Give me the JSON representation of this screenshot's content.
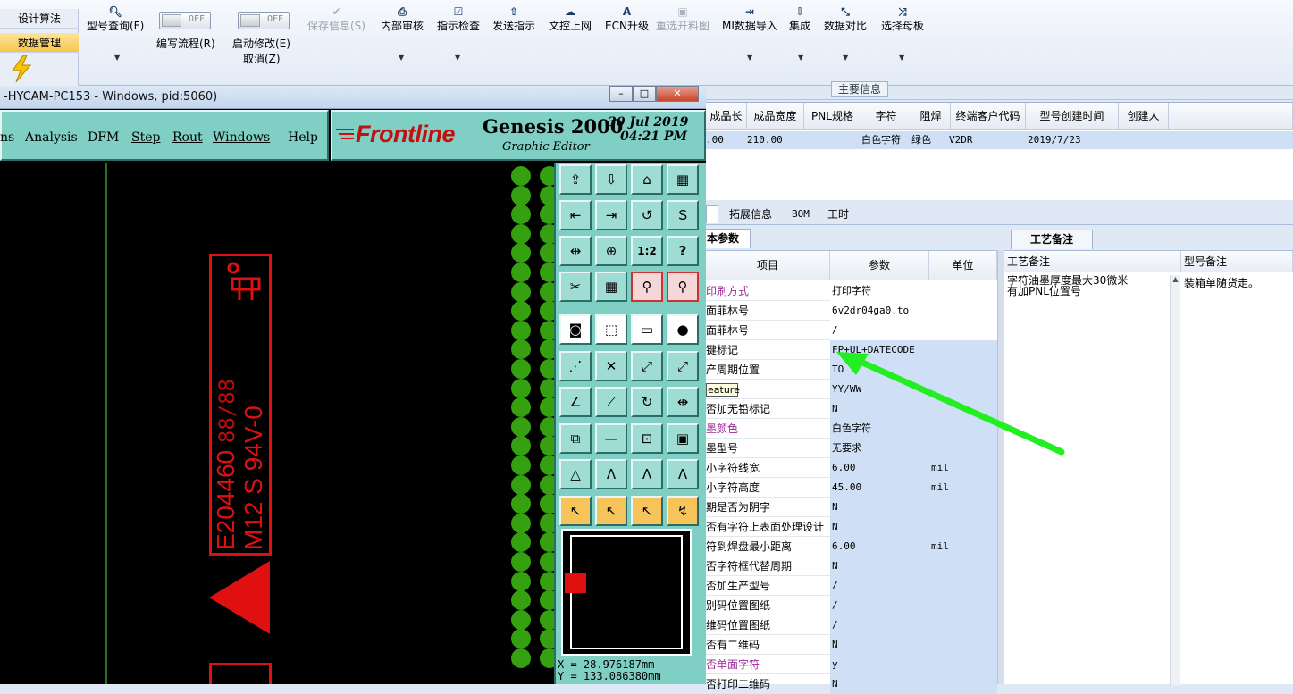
{
  "ribbon": {
    "nav": [
      "设计算法",
      "数据管理"
    ],
    "buttons": [
      {
        "label": "型号查询(F)",
        "icon": "search-icon",
        "enabled": true,
        "dropdown": true
      },
      {
        "label": "编写流程(R)",
        "icon": "toggle-switch",
        "enabled": true,
        "dropdown": false
      },
      {
        "label": "启动修改(E)",
        "label2": "取消(Z)",
        "icon": "toggle-switch",
        "enabled": true,
        "dropdown": false
      },
      {
        "label": "保存信息(S)",
        "icon": "check-icon",
        "enabled": false,
        "dropdown": false
      },
      {
        "label": "内部审核",
        "icon": "printer-icon",
        "enabled": true,
        "dropdown": true
      },
      {
        "label": "指示检查",
        "icon": "checkbox-icon",
        "enabled": true,
        "dropdown": true
      },
      {
        "label": "发送指示",
        "icon": "upload-icon",
        "enabled": true,
        "dropdown": false
      },
      {
        "label": "文控上网",
        "icon": "cloud-upload-icon",
        "enabled": true,
        "dropdown": false
      },
      {
        "label": "ECN升级",
        "icon": "ecn-icon",
        "enabled": true,
        "dropdown": false
      },
      {
        "label": "重选开料图",
        "icon": "image-icon",
        "enabled": false,
        "dropdown": false
      },
      {
        "label": "MI数据导入",
        "icon": "import-icon",
        "enabled": true,
        "dropdown": true
      },
      {
        "label": "集成",
        "icon": "download-icon",
        "enabled": true,
        "dropdown": true
      },
      {
        "label": "数据对比",
        "icon": "compare-icon",
        "enabled": true,
        "dropdown": true
      },
      {
        "label": "选择母板",
        "icon": "shuffle-icon",
        "enabled": true,
        "dropdown": true
      }
    ],
    "toggle_text": "OFF"
  },
  "main_info": {
    "section_title": "主要信息",
    "headers": [
      "成品长度",
      "成品宽度",
      "PNL规格",
      "字符",
      "阻焊",
      "终端客户代码",
      "型号创建时间",
      "创建人"
    ],
    "row": [
      ".00",
      "210.00",
      "",
      "白色字符",
      "绿色",
      "V2DR",
      "2019/7/23",
      ""
    ]
  },
  "tabs": [
    "拓展信息",
    "BOM",
    "工时"
  ],
  "params": {
    "tab_label": "本参数",
    "headers": [
      "项目",
      "参数",
      "单位"
    ],
    "tooltip": "eature",
    "rows": [
      {
        "item": "印刷方式",
        "value": "打印字符",
        "unit": "",
        "purple": true,
        "white": true
      },
      {
        "item": "面菲林号",
        "value": "6v2dr04ga0.to",
        "unit": "",
        "purple": false,
        "white": true
      },
      {
        "item": "面菲林号",
        "value": "/",
        "unit": "",
        "purple": false,
        "white": true
      },
      {
        "item": "键标记",
        "value": "FP+UL+DATECODE",
        "unit": "",
        "purple": false,
        "white": false
      },
      {
        "item": "产周期位置",
        "value": "TO",
        "unit": "",
        "purple": false,
        "white": false
      },
      {
        "item": "格式",
        "value": "YY/WW",
        "unit": "",
        "purple": false,
        "white": false
      },
      {
        "item": "否加无铅标记",
        "value": "N",
        "unit": "",
        "purple": false,
        "white": false
      },
      {
        "item": "墨颜色",
        "value": "白色字符",
        "unit": "",
        "purple": true,
        "white": false
      },
      {
        "item": "墨型号",
        "value": "无要求",
        "unit": "",
        "purple": false,
        "white": false
      },
      {
        "item": "小字符线宽",
        "value": "6.00",
        "unit": "mil",
        "purple": false,
        "white": false
      },
      {
        "item": "小字符高度",
        "value": "45.00",
        "unit": "mil",
        "purple": false,
        "white": false
      },
      {
        "item": "期是否为阴字",
        "value": "N",
        "unit": "",
        "purple": false,
        "white": false
      },
      {
        "item": "否有字符上表面处理设计",
        "value": "N",
        "unit": "",
        "purple": false,
        "white": false
      },
      {
        "item": "符到焊盘最小距离",
        "value": "6.00",
        "unit": "mil",
        "purple": false,
        "white": false
      },
      {
        "item": "否字符框代替周期",
        "value": "N",
        "unit": "",
        "purple": false,
        "white": false
      },
      {
        "item": "否加生产型号",
        "value": "/",
        "unit": "",
        "purple": false,
        "white": false
      },
      {
        "item": "别码位置图纸",
        "value": "/",
        "unit": "",
        "purple": false,
        "white": false
      },
      {
        "item": "维码位置图纸",
        "value": "/",
        "unit": "",
        "purple": false,
        "white": false
      },
      {
        "item": "否有二维码",
        "value": "N",
        "unit": "",
        "purple": false,
        "white": false
      },
      {
        "item": "否单面字符",
        "value": "y",
        "unit": "",
        "purple": true,
        "white": false
      },
      {
        "item": "否打印二维码",
        "value": "N",
        "unit": "",
        "purple": false,
        "white": false
      }
    ]
  },
  "remarks": {
    "tab_label": "工艺备注",
    "headers": [
      "工艺备注",
      "型号备注"
    ],
    "process_note": "字符油墨厚度最大30微米\n有加PNL位置号",
    "model_note": "装箱单随货走。"
  },
  "genesis": {
    "window_title": "-HYCAM-PC153 - Windows, pid:5060)",
    "menu": [
      "ns",
      "Analysis",
      "DFM",
      "Step",
      "Rout",
      "Windows",
      "Help"
    ],
    "logo": "Frontline",
    "product": "Genesis 2000",
    "subtitle": "Graphic Editor",
    "date": "30 Jul 2019",
    "time": "04:21 PM",
    "pcb_text_1": "E204460",
    "pcb_text_2": "M12 S 94V-0",
    "pcb_text_3": "88/88",
    "coord_x": "X = 28.976187mm",
    "coord_y": "Y = 133.086380mm",
    "tool_labels": [
      "1:2",
      "?"
    ]
  },
  "colors": {
    "annotation_arrow": "#22ee22",
    "pcb_red": "#e01010",
    "pad_green": "#36a110",
    "genesis_panel": "#7fcfc4"
  }
}
